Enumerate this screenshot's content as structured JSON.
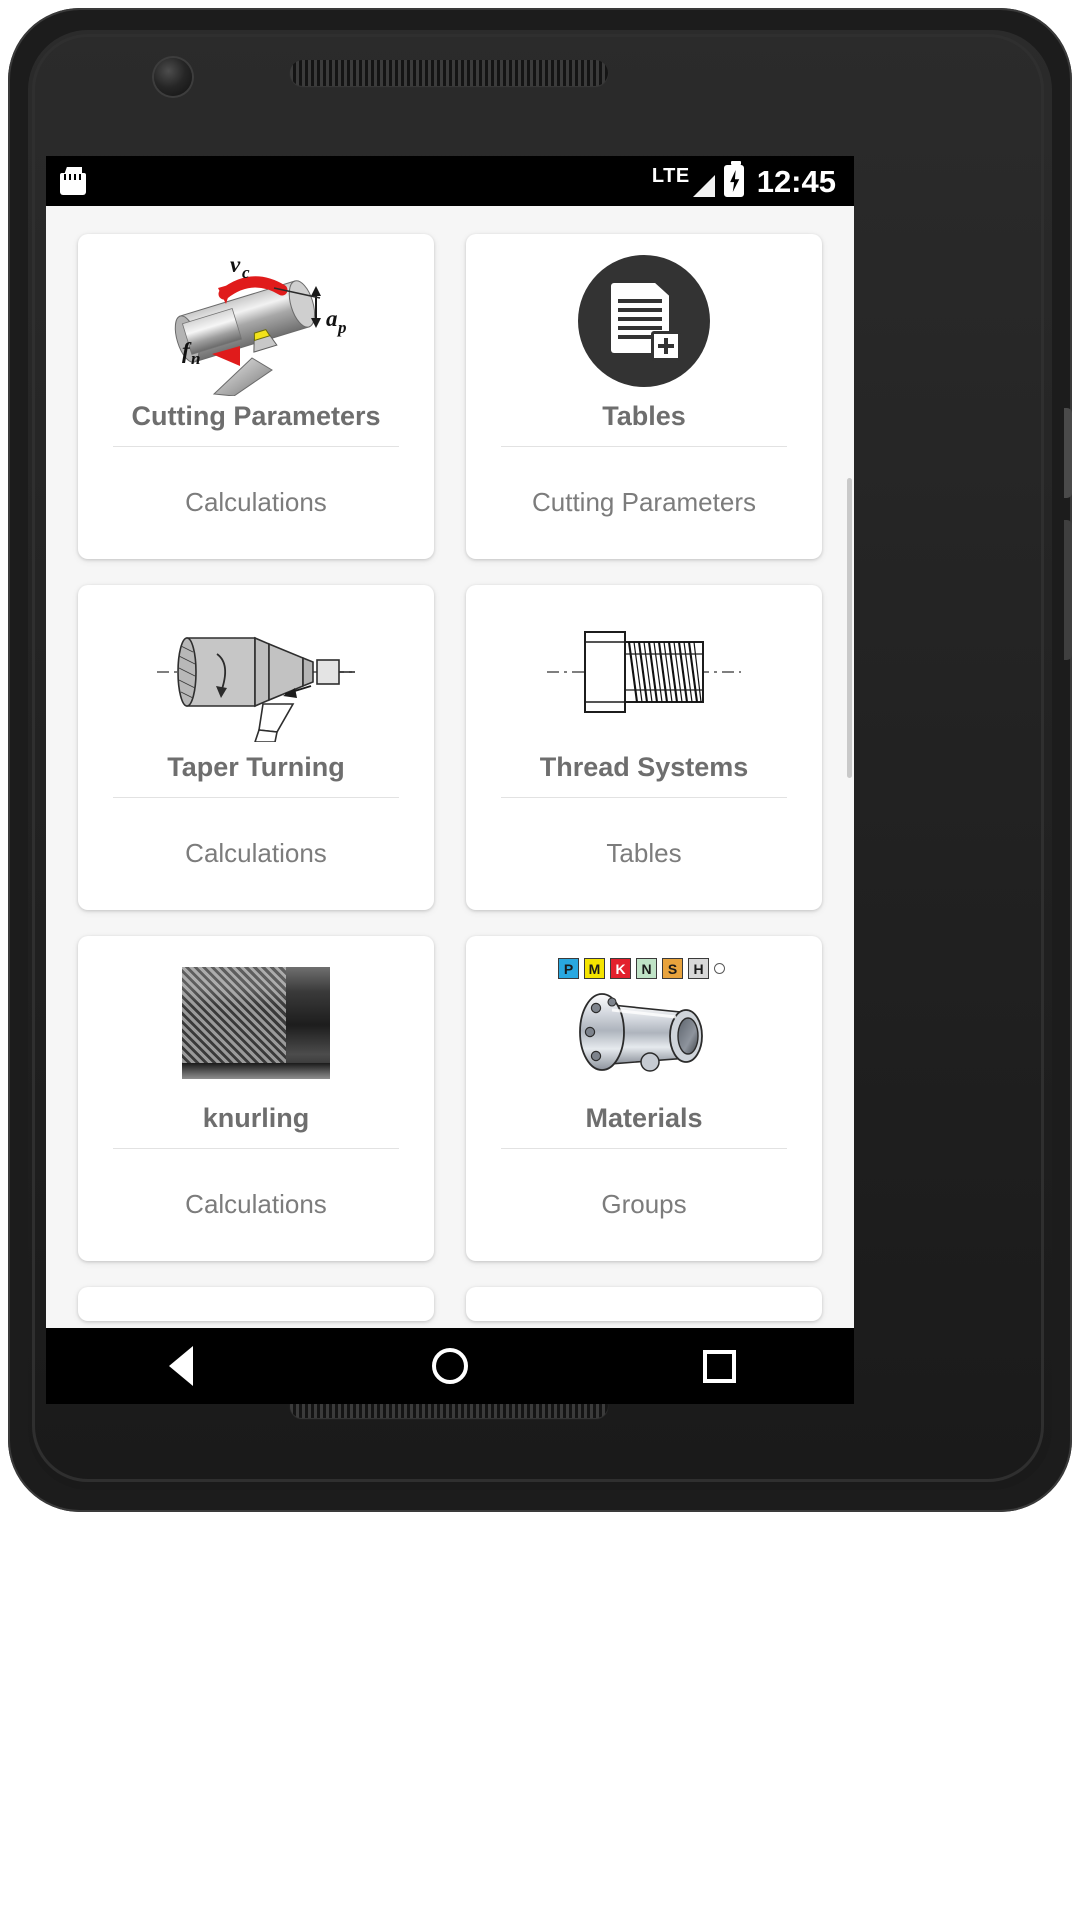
{
  "device": {
    "hardware": {
      "front_camera": "front-camera",
      "earpiece": "earpiece-speaker",
      "bottom_speaker": "bottom-speaker"
    }
  },
  "status_bar": {
    "sd_card_icon": "sd-card-icon",
    "network_label": "LTE",
    "signal_icon": "signal-bars-icon",
    "battery_icon": "battery-charging-icon",
    "time": "12:45"
  },
  "tiles": [
    {
      "title": "Cutting Parameters",
      "subtitle": "Calculations",
      "icon": "turning-cutting-parameters-diagram",
      "annotations": [
        "vc",
        "ap",
        "fn"
      ]
    },
    {
      "title": "Tables",
      "subtitle": "Cutting Parameters",
      "icon": "document-add-circle-icon"
    },
    {
      "title": "Taper Turning",
      "subtitle": "Calculations",
      "icon": "taper-turning-diagram"
    },
    {
      "title": "Thread Systems",
      "subtitle": "Tables",
      "icon": "thread-profile-diagram"
    },
    {
      "title": "knurling",
      "subtitle": "Calculations",
      "icon": "knurled-shaft-photo"
    },
    {
      "title": "Materials",
      "subtitle": "Groups",
      "icon": "iso-material-groups-chuck-icon",
      "iso_groups": [
        "P",
        "M",
        "K",
        "N",
        "S",
        "H"
      ]
    }
  ],
  "nav_bar": {
    "back_label": "Back",
    "home_label": "Home",
    "recents_label": "Recents"
  },
  "colors": {
    "status_bar_bg": "#000000",
    "page_bg": "#f6f6f6",
    "card_bg": "#ffffff",
    "title_text": "#6e6e6e",
    "subtitle_text": "#7c7c7c",
    "accent_dark": "#333333",
    "iso_p": "#29a8e0",
    "iso_m": "#f5e400",
    "iso_k": "#e3202c",
    "iso_n": "#bfe3c6",
    "iso_s": "#e8a33d",
    "iso_h": "#d8d8d8"
  }
}
